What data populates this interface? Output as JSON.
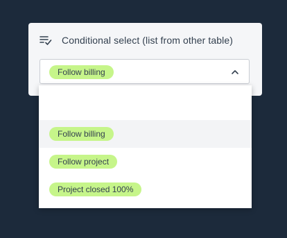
{
  "field": {
    "icon": "list-check-icon",
    "title": "Conditional select (list from other table)",
    "selected_value": "Follow billing"
  },
  "dropdown": {
    "options": [
      {
        "label": "Follow billing",
        "highlighted": true
      },
      {
        "label": "Follow project",
        "highlighted": false
      },
      {
        "label": "Project closed 100%",
        "highlighted": false
      }
    ]
  },
  "colors": {
    "background": "#1c2a3b",
    "card": "#f5f6f8",
    "tag": "#c6f58a",
    "text": "#33404f"
  }
}
